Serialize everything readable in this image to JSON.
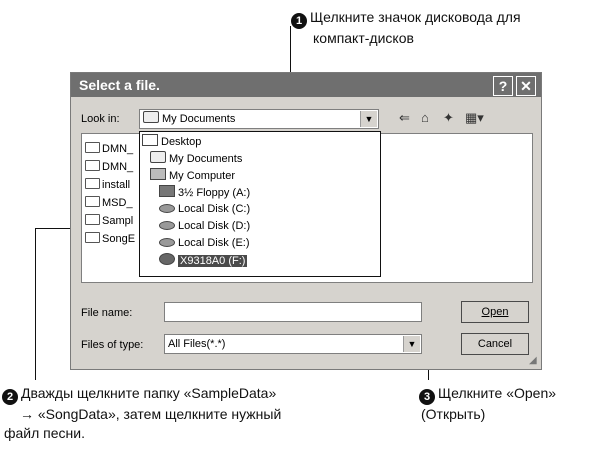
{
  "callouts": [
    {
      "number": "1",
      "lines": [
        "Щелкните значок дисковода для",
        "компакт-дисков"
      ]
    },
    {
      "number": "2",
      "lines": [
        "Дважды щелкните папку «SampleData»",
        "→ «SongData», затем щелкните нужный",
        "файл песни."
      ]
    },
    {
      "number": "3",
      "lines": [
        "Щелкните «Open»",
        "(Открыть)"
      ]
    }
  ],
  "dialog": {
    "title": "Select a file.",
    "help_glyph": "?",
    "close_glyph": "✕",
    "look_in_label": "Look in:",
    "look_in_value": "My Documents",
    "toolbar_glyphs": {
      "back": "⇐",
      "up": "⌂",
      "new_folder": "✦",
      "views": "▦▾"
    },
    "file_list": [
      "DMN_",
      "DMN_",
      "install",
      "MSD_",
      "Sampl",
      "SongE"
    ],
    "look_in_options": [
      {
        "label": "Desktop",
        "icon": "desktop-icon"
      },
      {
        "label": "My Documents",
        "icon": "my-documents-icon"
      },
      {
        "label": "My Computer",
        "icon": "my-computer-icon"
      },
      {
        "label": "3½ Floppy (A:)",
        "icon": "floppy-drive-icon"
      },
      {
        "label": "Local Disk (C:)",
        "icon": "local-disk-icon"
      },
      {
        "label": "Local Disk (D:)",
        "icon": "local-disk-icon"
      },
      {
        "label": "Local Disk (E:)",
        "icon": "local-disk-icon"
      },
      {
        "label": "X9318A0 (F:)",
        "icon": "cd-drive-icon",
        "selected": true
      }
    ],
    "file_name_label": "File name:",
    "file_name_value": "",
    "file_type_label": "Files of type:",
    "file_type_value": "All Files(*.*)",
    "open_label": "Open",
    "cancel_label": "Cancel"
  }
}
